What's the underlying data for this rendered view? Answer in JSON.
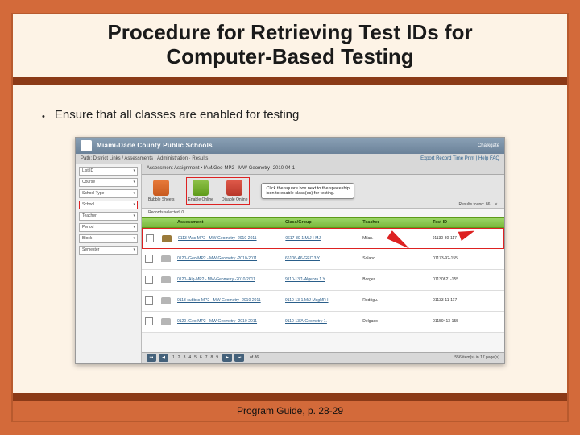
{
  "title_line1": "Procedure for Retrieving Test IDs for",
  "title_line2": "Computer-Based Testing",
  "bullet": "Ensure that all classes are enabled for testing",
  "footer": "Program Guide, p. 28-29",
  "shot": {
    "header_title": "Miami-Dade County Public Schools",
    "brand": "Chalkgate",
    "nav_path": "Path: District Links / Assessments · Administration · Results",
    "nav_right": "Export Record Time Print | Help FAQ",
    "breadcrumb": "Assessment Assignment • IAM/Geo-MP2 - MW-Geometry -2010-04-1",
    "records_selected": "Records selected: 0",
    "results_text": "Results found: 86",
    "sidebar": {
      "fields": [
        {
          "label": "List ID"
        },
        {
          "label": "Course"
        },
        {
          "label": "School Type"
        },
        {
          "label": "School"
        },
        {
          "label": "Teacher"
        },
        {
          "label": "Period"
        },
        {
          "label": "Block"
        },
        {
          "label": "Semester"
        }
      ]
    },
    "tools": [
      {
        "label": "Bubble Sheets",
        "cls": "bubble"
      },
      {
        "label": "Enable Online",
        "cls": "enable"
      },
      {
        "label": "Disable Online",
        "cls": "disable"
      }
    ],
    "tip": "Click the square box next to the spaceship icon to enable class(es) for testing.",
    "columns": [
      "",
      "",
      "Assessment",
      "Class/Group",
      "Teacher",
      "Test ID"
    ],
    "rows": [
      {
        "enabled": true,
        "hl": true,
        "assess": "0113-/Ass-MP2 - MW-Geometry -2010-2011",
        "class": "0617-80-1,M/J-I-MJ",
        "teach": "Milan.",
        "testid": "01130-80-117"
      },
      {
        "enabled": false,
        "hl": false,
        "assess": "0120-/Geo-MP2 - MW-Geometry -2010-2011",
        "class": "66106-A6-GEC 3 Y",
        "teach": "Solano.",
        "testid": "01173-92-155"
      },
      {
        "enabled": false,
        "hl": false,
        "assess": "0120-/Alg-MP2 - MW-Geometry -2010-2011",
        "class": "9110-13/1-Algebra 1 Y",
        "teach": "Borges.",
        "testid": "01130821-155"
      },
      {
        "enabled": false,
        "hl": false,
        "assess": "0113-subbss-MP2 - MW-Geometry -2010-2011",
        "class": "9110-13-1,M/J-MsgMR I",
        "teach": "Rodrigu.",
        "testid": "01133-11-117"
      },
      {
        "enabled": false,
        "hl": false,
        "assess": "0120-/Geo-MP2 - MW-Geometry -2010-2011",
        "class": "9110-13/A-Geometry 1.",
        "teach": "Delgado",
        "testid": "01159413-155"
      }
    ],
    "pager": {
      "pages": [
        "1",
        "2",
        "3",
        "4",
        "5",
        "6",
        "7",
        "8",
        "9"
      ],
      "right_of": "of 86",
      "right_items": "556 item(s) in 17 page(s)"
    }
  }
}
